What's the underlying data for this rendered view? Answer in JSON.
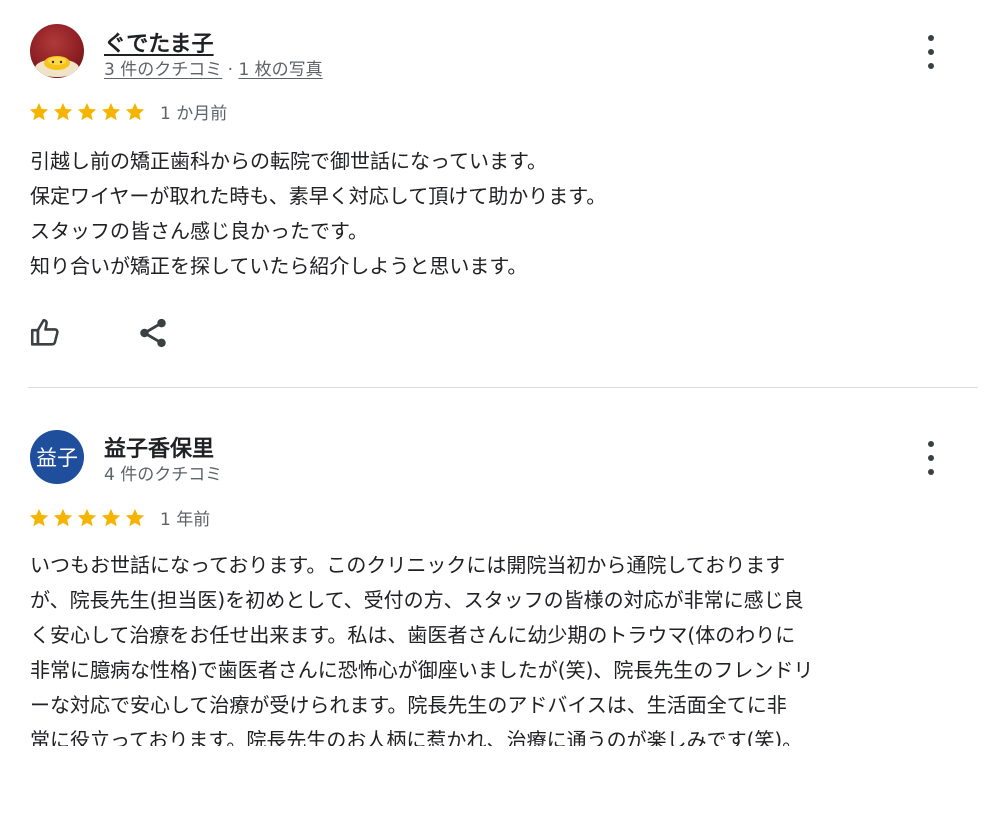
{
  "reviews": [
    {
      "reviewer_name": "ぐでたま子",
      "review_count": "3 件のクチコミ",
      "meta_separator": "·",
      "photo_count": "1 枚の写真",
      "rating": 5,
      "date": "1 か月前",
      "text_lines": [
        "引越し前の矯正歯科からの転院で御世話になっています。",
        "保定ワイヤーが取れた時も、素早く対応して頂けて助かります。",
        "スタッフの皆さん感じ良かったです。",
        "知り合いが矯正を探していたら紹介しようと思います。"
      ]
    },
    {
      "reviewer_name": "益子香保里",
      "avatar_text": "益子",
      "review_count": "4 件のクチコミ",
      "rating": 5,
      "date": "1 年前",
      "text_lines": [
        "いつもお世話になっております。このクリニックには開院当初から通院しております",
        "が、院長先生(担当医)を初めとして、受付の方、スタッフの皆様の対応が非常に感じ良",
        "く安心して治療をお任せ出来ます。私は、歯医者さんに幼少期のトラウマ(体のわりに",
        "非常に臆病な性格)で歯医者さんに恐怖心が御座いましたが(笑)、院長先生のフレンドリ",
        "ーな対応で安心して治療が受けられます。院長先生のアドバイスは、生活面全てに非",
        "常に役立っております。院長先生のお人柄に惹かれ、治療に通うのが楽しみです(笑)。"
      ]
    }
  ],
  "colors": {
    "star": "#f4b400",
    "text": "#202124",
    "secondary_text": "#5f6368",
    "divider": "#dadce0",
    "avatar_blue": "#1f4e9c"
  },
  "icons": {
    "more": "more-vert-icon",
    "like": "thumb-up-icon",
    "share": "share-icon",
    "star": "star-icon"
  }
}
